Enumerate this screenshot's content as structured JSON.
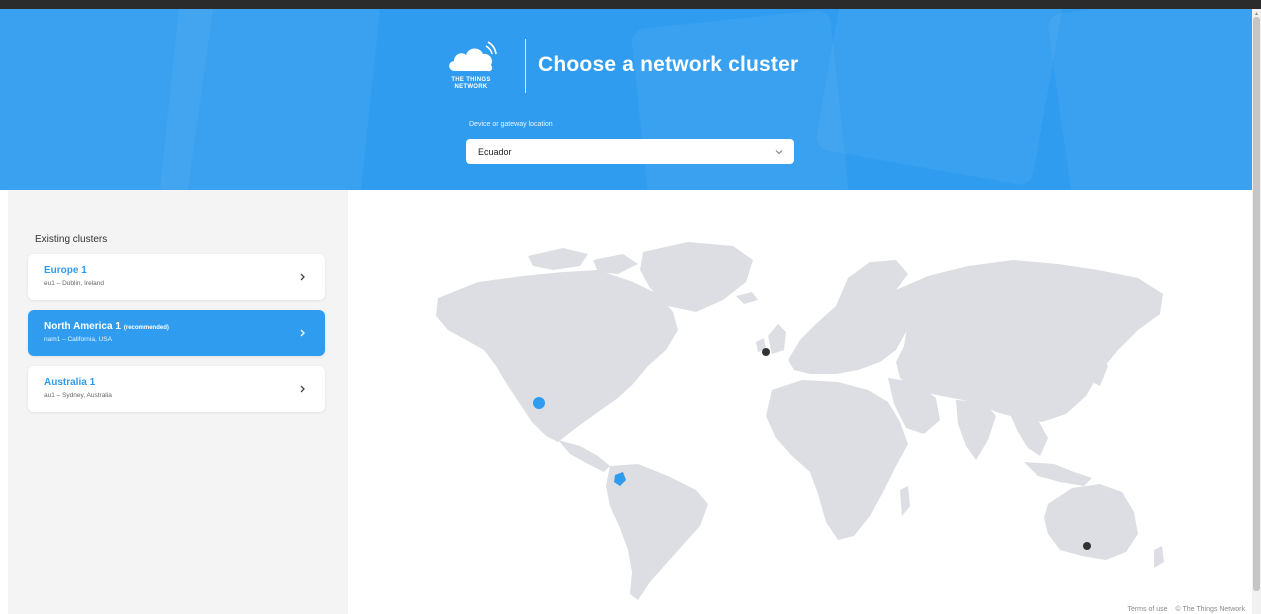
{
  "header": {
    "logo_text_line1": "THE THINGS",
    "logo_text_line2": "NETWORK",
    "title": "Choose a network cluster",
    "location_label": "Device or gateway location",
    "location_value": "Ecuador",
    "background_color": "#2f9cf0"
  },
  "sidebar": {
    "heading": "Existing clusters",
    "clusters": [
      {
        "name": "Europe 1",
        "badge": "",
        "detail": "eu1 – Dublin, Ireland",
        "active": false
      },
      {
        "name": "North America 1",
        "badge": "(recommended)",
        "detail": "nam1 – California, USA",
        "active": true
      },
      {
        "name": "Australia 1",
        "badge": "",
        "detail": "au1 – Sydney, Australia",
        "active": false
      }
    ]
  },
  "map": {
    "land_color": "#dcdee3",
    "markers": [
      {
        "name": "eu1-marker",
        "color": "#333333"
      },
      {
        "name": "nam1-marker",
        "color": "#2f9cf0"
      },
      {
        "name": "au1-marker",
        "color": "#333333"
      },
      {
        "name": "ecuador-marker",
        "color": "#2f9cf0"
      }
    ]
  },
  "footer": {
    "terms": "Terms of use",
    "copyright": "© The Things Network"
  }
}
